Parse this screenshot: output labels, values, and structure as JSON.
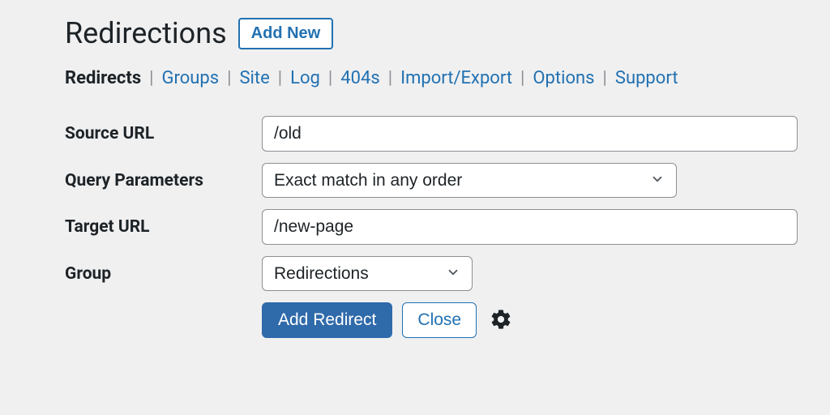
{
  "header": {
    "title": "Redirections",
    "add_new_label": "Add New"
  },
  "tabs": [
    {
      "label": "Redirects",
      "active": true
    },
    {
      "label": "Groups",
      "active": false
    },
    {
      "label": "Site",
      "active": false
    },
    {
      "label": "Log",
      "active": false
    },
    {
      "label": "404s",
      "active": false
    },
    {
      "label": "Import/Export",
      "active": false
    },
    {
      "label": "Options",
      "active": false
    },
    {
      "label": "Support",
      "active": false
    }
  ],
  "form": {
    "source_url": {
      "label": "Source URL",
      "value": "/old"
    },
    "query_parameters": {
      "label": "Query Parameters",
      "selected": "Exact match in any order"
    },
    "target_url": {
      "label": "Target URL",
      "value": "/new-page"
    },
    "group": {
      "label": "Group",
      "selected": "Redirections"
    }
  },
  "actions": {
    "add_redirect": "Add Redirect",
    "close": "Close"
  }
}
